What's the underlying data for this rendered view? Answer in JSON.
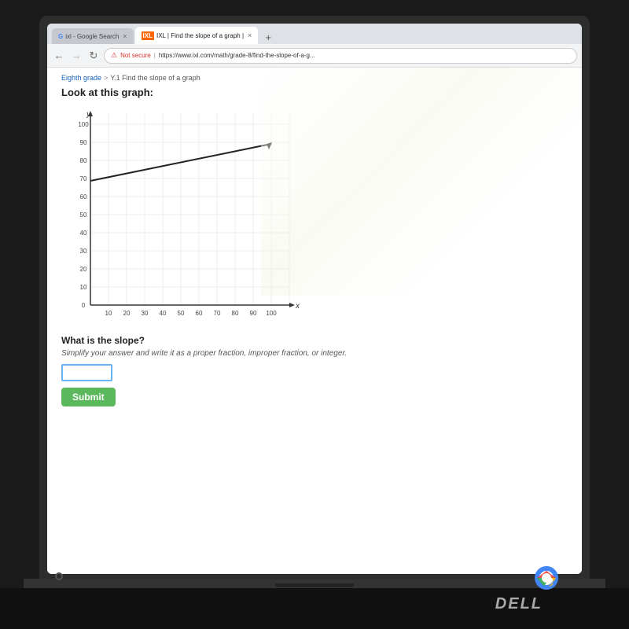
{
  "browser": {
    "tabs": [
      {
        "id": "tab-google",
        "label": "ixl - Google Search",
        "active": false,
        "favicon": "G"
      },
      {
        "id": "tab-ixl",
        "label": "IXL | Find the slope of a graph |",
        "active": true,
        "favicon": "IXL"
      }
    ],
    "tab_new_label": "+",
    "nav_back": "←",
    "nav_forward": "→",
    "nav_refresh": "↻",
    "warning_label": "Not secure",
    "address": "https://www.ixl.com/math/grade-8/find-the-slope-of-a-g..."
  },
  "breadcrumb": {
    "parent": "Eighth grade",
    "separator": ">",
    "current": "Y.1 Find the slope of a graph"
  },
  "page": {
    "title": "Look at this graph:",
    "graph": {
      "x_label": "x",
      "y_label": "y",
      "x_max": 100,
      "y_max": 100,
      "x_ticks": [
        10,
        20,
        30,
        40,
        50,
        60,
        70,
        80,
        90,
        100
      ],
      "y_ticks": [
        10,
        20,
        30,
        40,
        50,
        60,
        70,
        80,
        90,
        100
      ],
      "line_start": {
        "x": 0,
        "y": 70
      },
      "line_end": {
        "x": 100,
        "y": 90
      }
    },
    "question": "What is the slope?",
    "instruction": "Simplify your answer and write it as a proper fraction, improper fraction, or integer.",
    "answer_placeholder": "",
    "submit_label": "Submit"
  },
  "laptop": {
    "brand": "DELL"
  }
}
